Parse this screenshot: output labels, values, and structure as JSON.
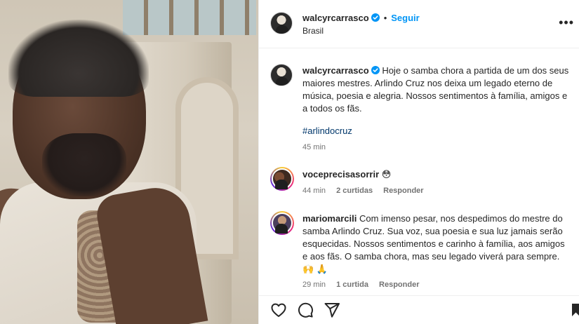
{
  "post": {
    "username": "walcyrcarrasco",
    "follow_label": "Seguir",
    "separator": "•",
    "location": "Brasil",
    "caption": "Hoje o samba chora a partida de um dos seus maiores mestres. Arlindo Cruz nos deixa um legado eterno de música, poesia e alegria. Nossos sentimentos à família, amigos e a todos os fãs.",
    "hashtag": "#arlindocruz",
    "time": "45 min"
  },
  "comments": [
    {
      "username": "voceprecisasorrir",
      "text": "😳",
      "time": "44 min",
      "likes": "2 curtidas",
      "reply": "Responder"
    },
    {
      "username": "mariomarcili",
      "text": "Com imenso pesar, nos despedimos do mestre do samba Arlindo Cruz. Sua voz, sua poesia e sua luz jamais serão esquecidas. Nossos sentimentos e carinho à família, aos amigos e aos fãs. O samba chora, mas seu legado viverá para sempre.🙌 🙏",
      "time": "29 min",
      "likes": "1 curtida",
      "reply": "Responder"
    }
  ],
  "icons": {
    "verified": "verified-badge-icon",
    "like": "heart-icon",
    "comment": "comment-icon",
    "share": "share-icon",
    "save": "bookmark-icon",
    "more": "more-options-icon"
  },
  "colors": {
    "follow": "#0095f6",
    "hashtag": "#00376b",
    "meta": "#737373"
  }
}
